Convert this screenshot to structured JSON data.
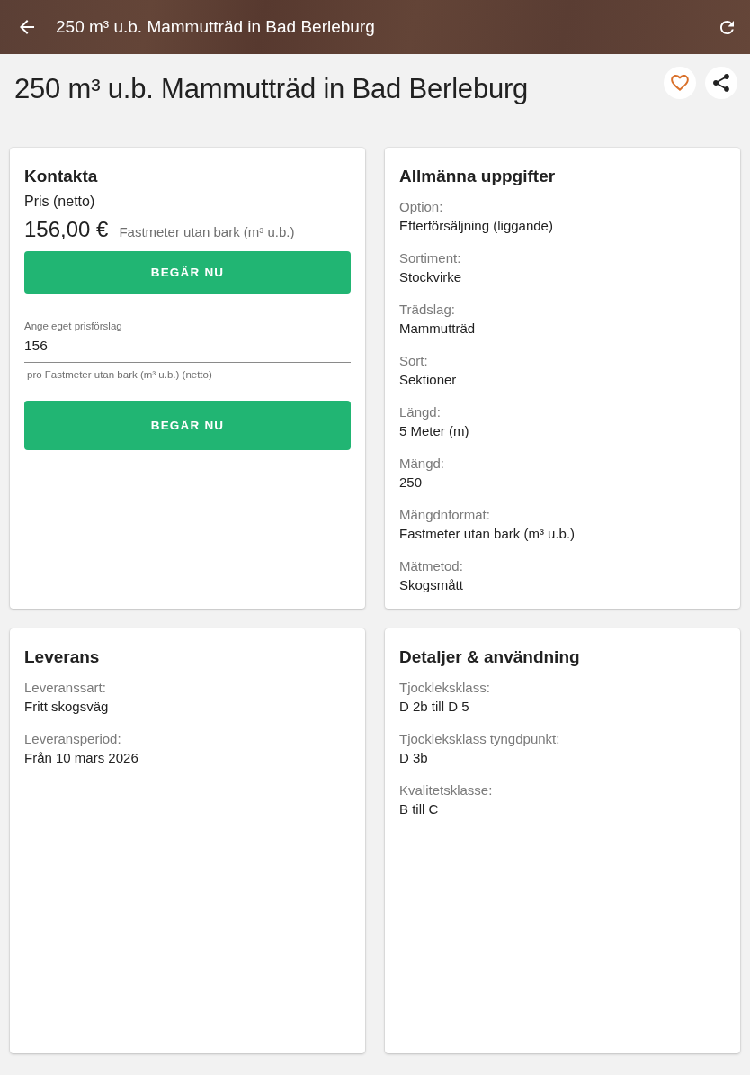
{
  "app_bar": {
    "title": "250 m³ u.b. Mammutträd in Bad Berleburg"
  },
  "page_title": "250 m³ u.b. Mammutträd in Bad Berleburg",
  "favorited": false,
  "cards": [
    {
      "kind": "contact",
      "title": "Kontakta",
      "price_label": "Pris (netto)",
      "price": "156,00 €",
      "unit": "Fastmeter utan bark (m³ u.b.)",
      "request_button": "BEGÄR NU",
      "offer_field": {
        "label": "Ange eget prisförslag",
        "value": "156",
        "helper": "pro Fastmeter utan bark (m³ u.b.) (netto)"
      },
      "offer_button": "BEGÄR NU"
    },
    {
      "kind": "details",
      "title": "Allmänna uppgifter",
      "fields": [
        {
          "label": "Option:",
          "value": "Efterförsäljning (liggande)"
        },
        {
          "label": "Sortiment:",
          "value": "Stockvirke"
        },
        {
          "label": "Trädslag:",
          "value": "Mammutträd"
        },
        {
          "label": "Sort:",
          "value": "Sektioner"
        },
        {
          "label": "Längd:",
          "value": "5 Meter (m)"
        },
        {
          "label": "Mängd:",
          "value": "250"
        },
        {
          "label": "Mängdnformat:",
          "value": "Fastmeter utan bark (m³ u.b.)"
        },
        {
          "label": "Mätmetod:",
          "value": "Skogsmått"
        }
      ]
    },
    {
      "kind": "details",
      "title": "Leverans",
      "fields": [
        {
          "label": "Leveranssart:",
          "value": "Fritt skogsväg"
        },
        {
          "label": "Leveransperiod:",
          "value": "Från 10 mars 2026"
        }
      ]
    },
    {
      "kind": "details",
      "title": "Detaljer & användning",
      "fields": [
        {
          "label": "Tjockleksklass:",
          "value": "D 2b till D 5"
        },
        {
          "label": "Tjockleksklass tyngdpunkt:",
          "value": "D 3b"
        },
        {
          "label": "Kvalitetsklasse:",
          "value": "B till C"
        }
      ]
    }
  ]
}
